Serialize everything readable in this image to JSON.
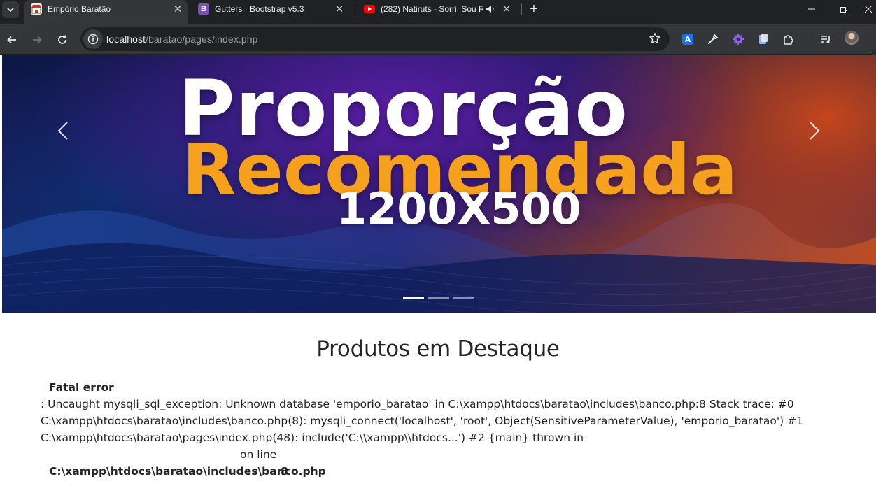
{
  "browser": {
    "tabs": [
      {
        "title": "Empório Baratão",
        "active": true
      },
      {
        "title": "Gutters · Bootstrap v5.3",
        "active": false
      },
      {
        "title": "(282) Natiruts - Sorri, Sou Rei",
        "active": false
      }
    ],
    "url_host": "localhost",
    "url_path": "/baratao/pages/index.php",
    "colors": {
      "bootstrap": "#7952b3",
      "youtube": "#ff0000",
      "chrome_dark": "#202124",
      "chrome_mid": "#35363a"
    }
  },
  "carousel": {
    "line1": "Proporção",
    "line2": "Recomendada",
    "line3": "1200X500",
    "slide_count": 3,
    "active_slide": 1,
    "colors": {
      "accent": "#f5a11d"
    }
  },
  "main": {
    "section_title": "Produtos em Destaque",
    "error": {
      "heading": "Fatal error",
      "line1": ": Uncaught mysqli_sql_exception: Unknown database 'emporio_baratao' in C:\\xampp\\htdocs\\baratao\\includes\\banco.php:8 Stack trace: #0",
      "line2": "C:\\xampp\\htdocs\\baratao\\includes\\banco.php(8): mysqli_connect('localhost', 'root', Object(SensitiveParameterValue), 'emporio_baratao') #1",
      "line3": "C:\\xampp\\htdocs\\baratao\\pages\\index.php(48): include('C:\\\\xampp\\\\htdocs...') #2 {main} thrown in",
      "on_line": "on line",
      "file": "C:\\xampp\\htdocs\\baratao\\includes\\banco.php",
      "line_number": "8"
    }
  }
}
